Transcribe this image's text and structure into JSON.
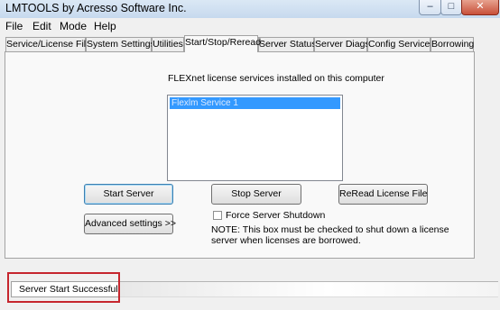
{
  "window": {
    "title": "LMTOOLS by Acresso Software Inc.",
    "controls": {
      "minimize": "–",
      "maximize": "□",
      "close": "✕"
    }
  },
  "menu": {
    "items": [
      "File",
      "Edit",
      "Mode",
      "Help"
    ]
  },
  "tabs": {
    "items": [
      "Service/License File",
      "System Settings",
      "Utilities",
      "Start/Stop/Reread",
      "Server Status",
      "Server Diags",
      "Config Services",
      "Borrowing"
    ],
    "active": "Start/Stop/Reread"
  },
  "panel": {
    "list_label": "FLEXnet license services installed on this computer",
    "list_items": [
      "Flexlm Service 1"
    ],
    "buttons": {
      "start": "Start Server",
      "stop": "Stop Server",
      "reread": "ReRead License File",
      "advanced": "Advanced settings >>"
    },
    "force_shutdown": {
      "label": "Force Server Shutdown",
      "checked": false
    },
    "note": "NOTE:  This box must be checked to shut down a license server when licenses are borrowed."
  },
  "status": {
    "text": "Server Start Successful."
  },
  "colors": {
    "selection": "#3399ff",
    "highlight_box": "#c6262e",
    "title_bar": "#c6d9ee"
  }
}
